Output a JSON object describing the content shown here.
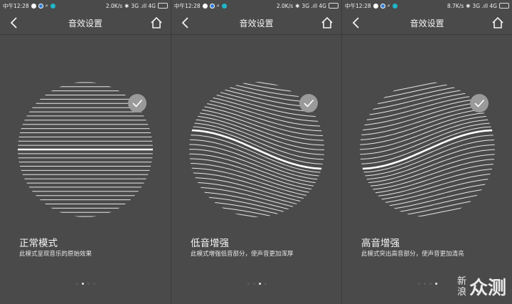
{
  "panels": [
    {
      "status": {
        "time": "中午12:28",
        "speed": "2.0K/s",
        "network": "3G .ıll 4G"
      },
      "nav_title": "音效设置",
      "mode_title": "正常模式",
      "mode_desc": "此模式呈现音乐的原始效果",
      "curve": "flat",
      "page_index": 1
    },
    {
      "status": {
        "time": "中午12:28",
        "speed": "2.0K/s",
        "network": "3G .ıll 4G"
      },
      "nav_title": "音效设置",
      "mode_title": "低音增强",
      "mode_desc": "此模式增强低音部分，使声音更加浑厚",
      "curve": "bass",
      "page_index": 2
    },
    {
      "status": {
        "time": "中午12:28",
        "speed": "8.7K/s",
        "network": "3G .ıll 4G"
      },
      "nav_title": "音效设置",
      "mode_title": "高音增强",
      "mode_desc": "此模式突出高音部分，使声音更加清亮",
      "curve": "treble",
      "page_index": 3
    }
  ],
  "page_count": 4,
  "watermark": {
    "left_top": "新",
    "left_bottom": "浪",
    "right": "众测"
  },
  "colors": {
    "background": "#4a4a4a",
    "lines": "#e6e6e6",
    "highlight": "#ffffff",
    "check_bg": "#9a9a9a"
  }
}
